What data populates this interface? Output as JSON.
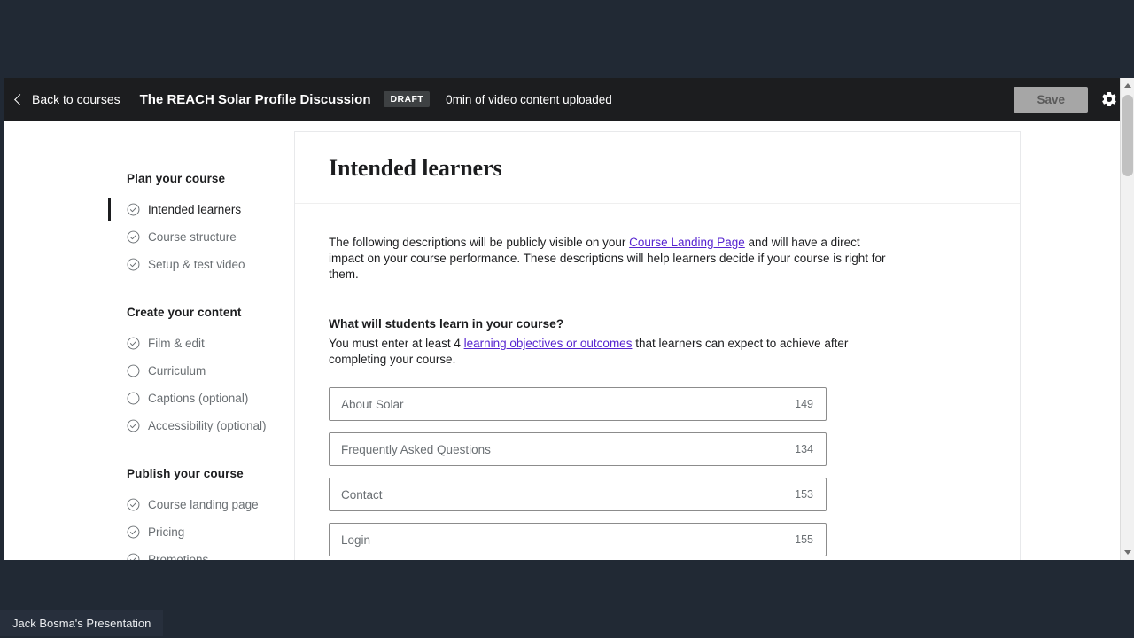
{
  "appbar": {
    "back_label": "Back to courses",
    "back_icon": "chevron-left-icon",
    "course_title": "The REACH Solar Profile Discussion",
    "status_badge": "DRAFT",
    "upload_status": "0min of video content uploaded",
    "save_label": "Save",
    "settings_icon": "gear-icon",
    "bar_color": "#1c1d1f",
    "badge_color": "#3e4143",
    "save_button_color": "#a6a6a6"
  },
  "sidebar": {
    "groups": [
      {
        "title": "Plan your course",
        "items": [
          {
            "label": "Intended learners",
            "state": "complete",
            "active": true
          },
          {
            "label": "Course structure",
            "state": "complete",
            "active": false
          },
          {
            "label": "Setup & test video",
            "state": "complete",
            "active": false
          }
        ]
      },
      {
        "title": "Create your content",
        "items": [
          {
            "label": "Film & edit",
            "state": "complete",
            "active": false
          },
          {
            "label": "Curriculum",
            "state": "incomplete",
            "active": false
          },
          {
            "label": "Captions (optional)",
            "state": "incomplete",
            "active": false
          },
          {
            "label": "Accessibility (optional)",
            "state": "complete",
            "active": false
          }
        ]
      },
      {
        "title": "Publish your course",
        "items": [
          {
            "label": "Course landing page",
            "state": "complete",
            "active": false
          },
          {
            "label": "Pricing",
            "state": "complete",
            "active": false
          },
          {
            "label": "Promotions",
            "state": "complete",
            "active": false
          }
        ]
      }
    ]
  },
  "main": {
    "page_title": "Intended learners",
    "intro_part1": "The following descriptions will be publicly visible on your ",
    "intro_link": "Course Landing Page",
    "intro_part2": " and will have a direct impact on your course performance. These descriptions will help learners decide if your course is right for them.",
    "question": "What will students learn in your course?",
    "requirement_part1": "You must enter at least 4 ",
    "requirement_link": "learning objectives or outcomes",
    "requirement_part2": " that learners can expect to achieve after completing your course.",
    "link_color": "#5624d0",
    "objectives": [
      {
        "value": "About Solar",
        "count": "149"
      },
      {
        "value": "Frequently Asked Questions",
        "count": "134"
      },
      {
        "value": "Contact",
        "count": "153"
      },
      {
        "value": "Login",
        "count": "155"
      },
      {
        "value": "",
        "count": ""
      }
    ]
  },
  "scrollbar": {
    "up_icon": "triangle-up-icon",
    "down_icon": "triangle-down-icon"
  },
  "taskbar": {
    "item_label": "Jack Bosma's Presentation"
  }
}
